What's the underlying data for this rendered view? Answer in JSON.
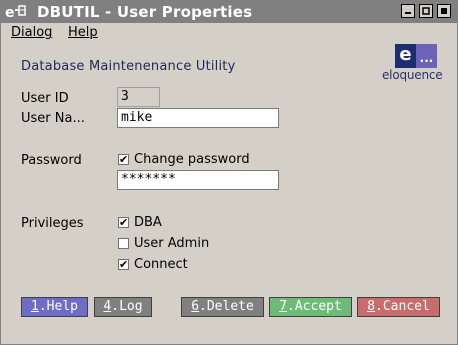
{
  "window": {
    "title": "DBUTIL - User Properties",
    "icon": "e-app-icon",
    "controls": [
      "minimize",
      "maximize",
      "close"
    ]
  },
  "menu": {
    "items": [
      {
        "label": "Dialog"
      },
      {
        "label": "Help"
      }
    ]
  },
  "header": {
    "heading": "Database Maintenenance Utility",
    "logo_text": "eloquence",
    "logo_mark_left": "e",
    "logo_mark_right": "..."
  },
  "form": {
    "user_id_label": "User ID",
    "user_id_value": "3",
    "user_name_label": "User Na...",
    "user_name_value": "mike",
    "password_label": "Password",
    "change_password_label": "Change password",
    "change_password_checked": true,
    "password_value": "*******",
    "privileges_label": "Privileges",
    "privileges": [
      {
        "label": "DBA",
        "checked": true
      },
      {
        "label": "User Admin",
        "checked": false
      },
      {
        "label": "Connect",
        "checked": true
      }
    ]
  },
  "buttons": {
    "help": {
      "key": "1",
      "text": ".Help",
      "color": "#6d6dc8"
    },
    "log": {
      "key": "4",
      "text": ".Log",
      "color": "#808080"
    },
    "delete": {
      "key": "6",
      "text": ".Delete",
      "color": "#808080"
    },
    "accept": {
      "key": "7",
      "text": ".Accept",
      "color": "#6cbc78"
    },
    "cancel": {
      "key": "8",
      "text": ".Cancel",
      "color": "#c86c6c"
    }
  },
  "colors": {
    "titlebar": "#808080",
    "background": "#d4d0c8"
  }
}
